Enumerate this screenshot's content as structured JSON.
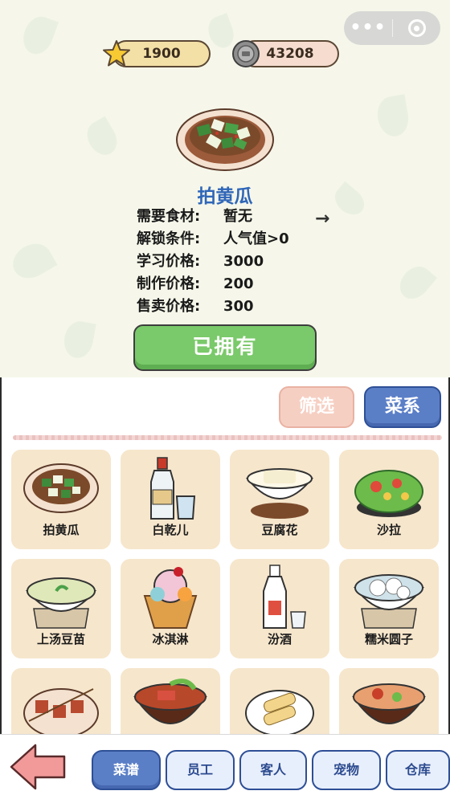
{
  "currency": {
    "stars": "1900",
    "coins": "43208"
  },
  "selected_dish": {
    "name": "拍黄瓜",
    "arrow": "→",
    "info": [
      {
        "label": "需要食材:",
        "value": "暂无"
      },
      {
        "label": "解锁条件:",
        "value": "人气值>0"
      },
      {
        "label": "学习价格:",
        "value": "3000"
      },
      {
        "label": "制作价格:",
        "value": "200"
      },
      {
        "label": "售卖价格:",
        "value": "300"
      }
    ],
    "owned_label": "已拥有"
  },
  "filters": {
    "filter_label": "筛选",
    "cuisine_label": "菜系"
  },
  "dishes": [
    {
      "name": "拍黄瓜",
      "icon": "cucumber-salad-icon"
    },
    {
      "name": "白乾儿",
      "icon": "liquor-bottle-icon"
    },
    {
      "name": "豆腐花",
      "icon": "tofu-pudding-icon"
    },
    {
      "name": "沙拉",
      "icon": "salad-icon"
    },
    {
      "name": "上汤豆苗",
      "icon": "pea-shoot-soup-icon"
    },
    {
      "name": "冰淇淋",
      "icon": "ice-cream-icon"
    },
    {
      "name": "汾酒",
      "icon": "fen-liquor-icon"
    },
    {
      "name": "糯米圆子",
      "icon": "rice-ball-soup-icon"
    },
    {
      "name": "",
      "icon": "skewers-icon"
    },
    {
      "name": "",
      "icon": "noodle-bowl-icon"
    },
    {
      "name": "",
      "icon": "spring-roll-icon"
    },
    {
      "name": "",
      "icon": "bibimbap-icon"
    }
  ],
  "nav": {
    "tabs": [
      "菜谱",
      "员工",
      "客人",
      "宠物",
      "仓库"
    ],
    "active": 0
  },
  "colors": {
    "accent_blue": "#5b7fc7",
    "owned_green": "#7ac96a",
    "title_blue": "#2f66b8",
    "card_bg": "#f6e6cc"
  }
}
